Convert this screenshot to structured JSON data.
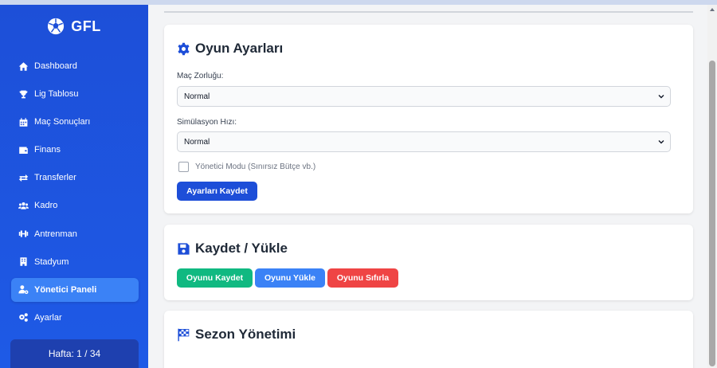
{
  "brand": {
    "name": "GFL",
    "icon": "football-icon"
  },
  "sidebar": {
    "items": [
      {
        "label": "Dashboard",
        "icon": "home-icon",
        "active": false
      },
      {
        "label": "Lig Tablosu",
        "icon": "trophy-icon",
        "active": false
      },
      {
        "label": "Maç Sonuçları",
        "icon": "calendar-icon",
        "active": false
      },
      {
        "label": "Finans",
        "icon": "wallet-icon",
        "active": false
      },
      {
        "label": "Transferler",
        "icon": "exchange-icon",
        "active": false
      },
      {
        "label": "Kadro",
        "icon": "users-icon",
        "active": false
      },
      {
        "label": "Antrenman",
        "icon": "dumbbell-icon",
        "active": false
      },
      {
        "label": "Stadyum",
        "icon": "building-icon",
        "active": false
      },
      {
        "label": "Yönetici Paneli",
        "icon": "user-cog-icon",
        "active": true
      },
      {
        "label": "Ayarlar",
        "icon": "cogs-icon",
        "active": false
      }
    ],
    "week_label": "Hafta: 1 / 34"
  },
  "settings": {
    "title": "Oyun Ayarları",
    "difficulty_label": "Maç Zorluğu:",
    "difficulty_value": "Normal",
    "speed_label": "Simülasyon Hızı:",
    "speed_value": "Normal",
    "admin_mode_label": "Yönetici Modu (Sınırsız Bütçe vb.)",
    "admin_mode_checked": false,
    "save_button": "Ayarları Kaydet"
  },
  "saveload": {
    "title": "Kaydet / Yükle",
    "save_button": "Oyunu Kaydet",
    "load_button": "Oyunu Yükle",
    "reset_button": "Oyunu Sıfırla"
  },
  "season": {
    "title": "Sezon Yönetimi"
  },
  "colors": {
    "sidebar": "#1d4fd8",
    "active_item": "#3b82f6",
    "primary_button": "#1d4ed8",
    "save_green": "#10b981",
    "load_blue": "#3b82f6",
    "reset_red": "#ef4444"
  }
}
